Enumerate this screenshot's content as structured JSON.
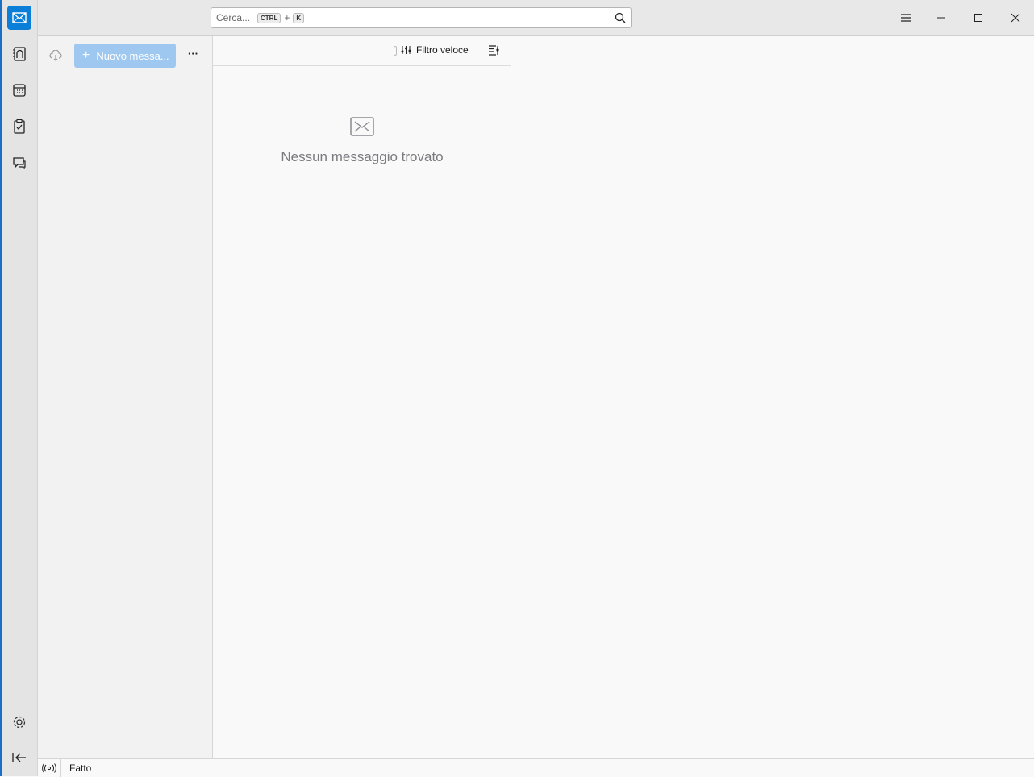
{
  "spaces": {
    "items": [
      "mail-icon",
      "address-book-icon",
      "calendar-icon",
      "tasks-icon",
      "chat-icon"
    ],
    "settings": "gear-icon",
    "collapse": "collapse-icon"
  },
  "search": {
    "placeholder": "Cerca...",
    "shortcut_mod": "CTRL",
    "shortcut_plus": "+",
    "shortcut_key": "K"
  },
  "folder_pane": {
    "new_message_label": "Nuovo messa...",
    "more_label": "···"
  },
  "message_list": {
    "quick_filter_label": "Filtro veloce",
    "empty_text": "Nessun messaggio trovato"
  },
  "status_bar": {
    "text": "Fatto"
  },
  "colors": {
    "accent": "#0b7ed8",
    "new_button": "#9ec8ef"
  }
}
